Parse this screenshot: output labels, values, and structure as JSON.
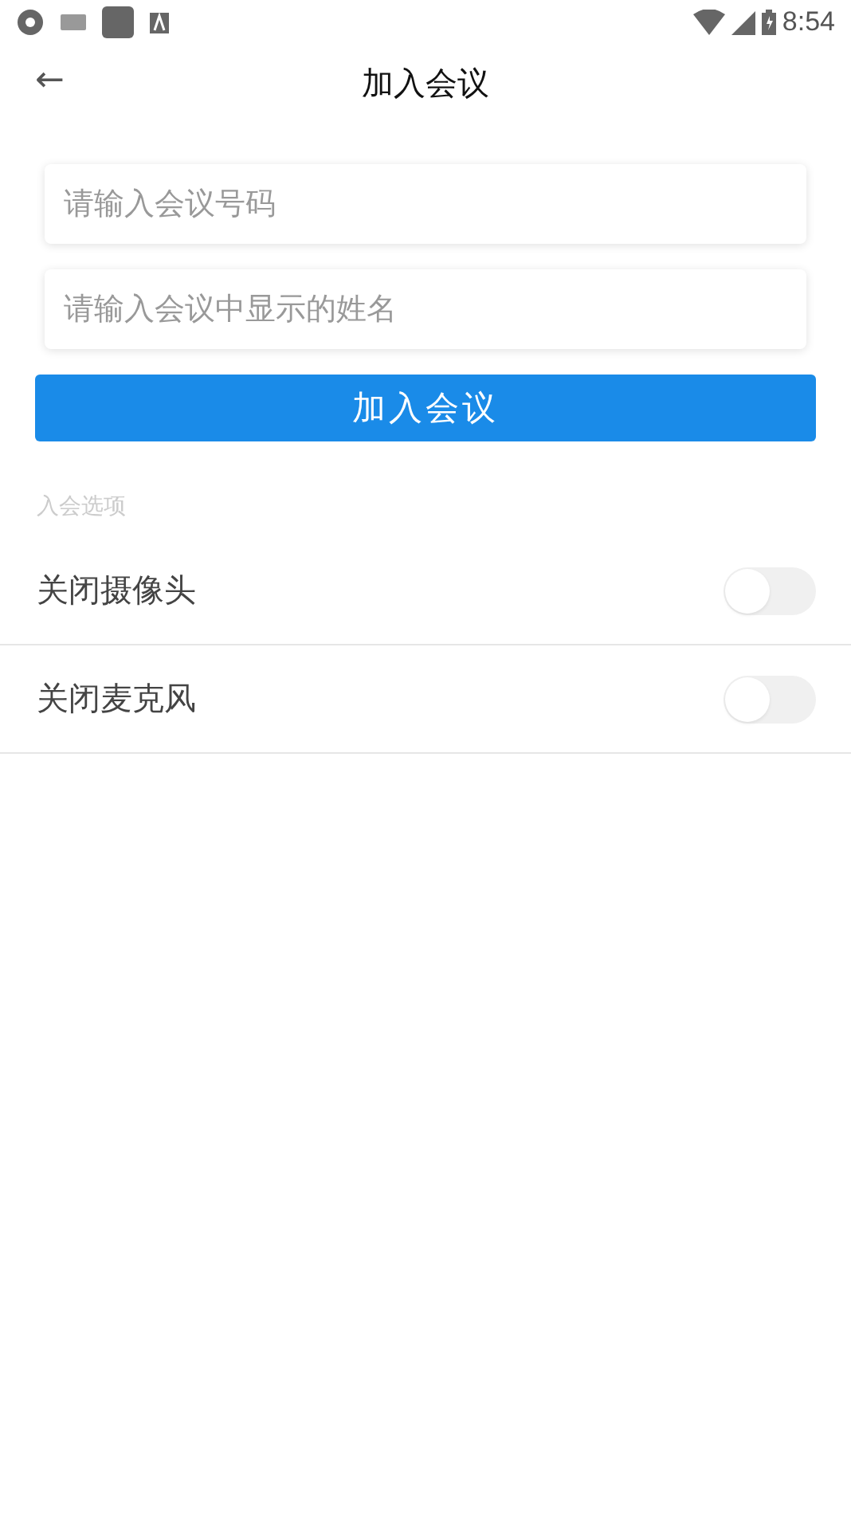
{
  "status_bar": {
    "time": "8:54"
  },
  "header": {
    "back": "←",
    "title": "加入会议"
  },
  "fields": [
    {
      "placeholder": "请输入会议号码"
    },
    {
      "placeholder": "请输入会议中显示的姓名"
    }
  ],
  "join_button": "加入会议",
  "options": {
    "heading": "入会选项",
    "items": [
      {
        "label": "关闭摄像头",
        "on": false
      },
      {
        "label": "关闭麦克风",
        "on": false
      }
    ]
  }
}
